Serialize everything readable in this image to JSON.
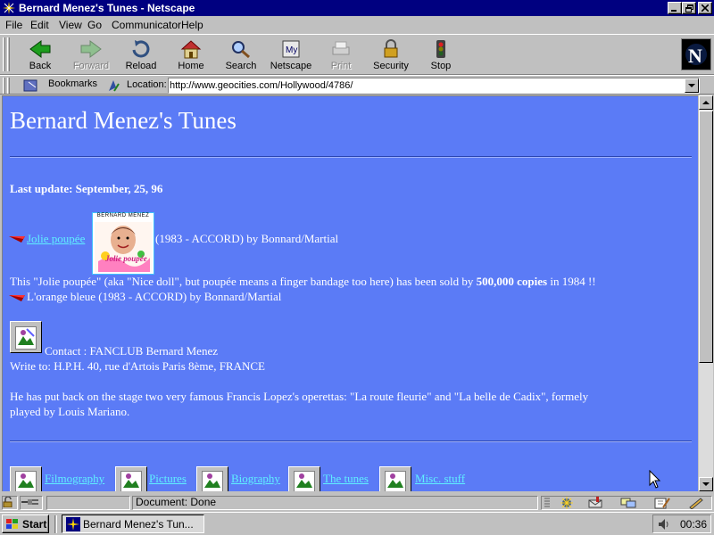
{
  "window": {
    "title": "Bernard Menez's Tunes - Netscape",
    "controls": [
      "minimize-icon",
      "restore-icon",
      "close-icon"
    ]
  },
  "menu": [
    "File",
    "Edit",
    "View",
    "Go",
    "Communicator",
    "Help"
  ],
  "toolbar": {
    "back": "Back",
    "forward": "Forward",
    "reload": "Reload",
    "home": "Home",
    "search": "Search",
    "netscape": "Netscape",
    "print": "Print",
    "security": "Security",
    "stop": "Stop"
  },
  "location": {
    "bookmarks_label": "Bookmarks",
    "location_label": "Location:",
    "url": "http://www.geocities.com/Hollywood/4786/"
  },
  "page": {
    "heading": "Bernard Menez's Tunes",
    "last_update": "Last update: September, 25, 96",
    "song1_link": "Jolie poupée",
    "song1_details": "(1983 - ACCORD) by Bonnard/Martial",
    "album_cover_text": "BERNARD MENEZ",
    "album_cover_title": "Jolie poupée",
    "description_pre": "This \"Jolie poupée\" (aka \"Nice doll\", but poupée means a finger bandage too here) has been sold by ",
    "description_bold": "500,000 copies",
    "description_post": " in 1984 !!",
    "song2": "L'orange bleue (1983 - ACCORD) by Bonnard/Martial",
    "contact": "Contact : FANCLUB Bernard Menez",
    "write_to": "Write to: H.P.H. 40, rue d'Artois Paris 8ème, FRANCE",
    "stage_line1": "He has put back on the stage two very famous Francis Lopez's operettas: \"La route fleurie\" and \"La belle de Cadix\", formely",
    "stage_line2": "played by Louis Mariano.",
    "nav_links": [
      "Filmography",
      "Pictures",
      "Biography",
      "The tunes",
      "Misc. stuff"
    ]
  },
  "status": {
    "text": "Document: Done"
  },
  "taskbar": {
    "start": "Start",
    "task": "Bernard Menez's Tun...",
    "clock": "00:36"
  },
  "colors": {
    "page_background": "#5b7bf6",
    "link": "#5ff0ff",
    "titlebar": "#000080"
  }
}
